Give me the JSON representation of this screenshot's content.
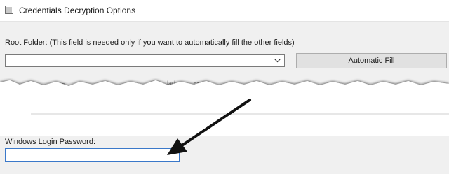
{
  "window": {
    "title": "Credentials Decryption Options"
  },
  "root_folder": {
    "label": "Root Folder: (This field is needed only if you want to automatically fill the other fields)",
    "value": ""
  },
  "automatic_fill": {
    "label": "Automatic Fill"
  },
  "password": {
    "label": "Windows Login Password:",
    "value": ""
  }
}
